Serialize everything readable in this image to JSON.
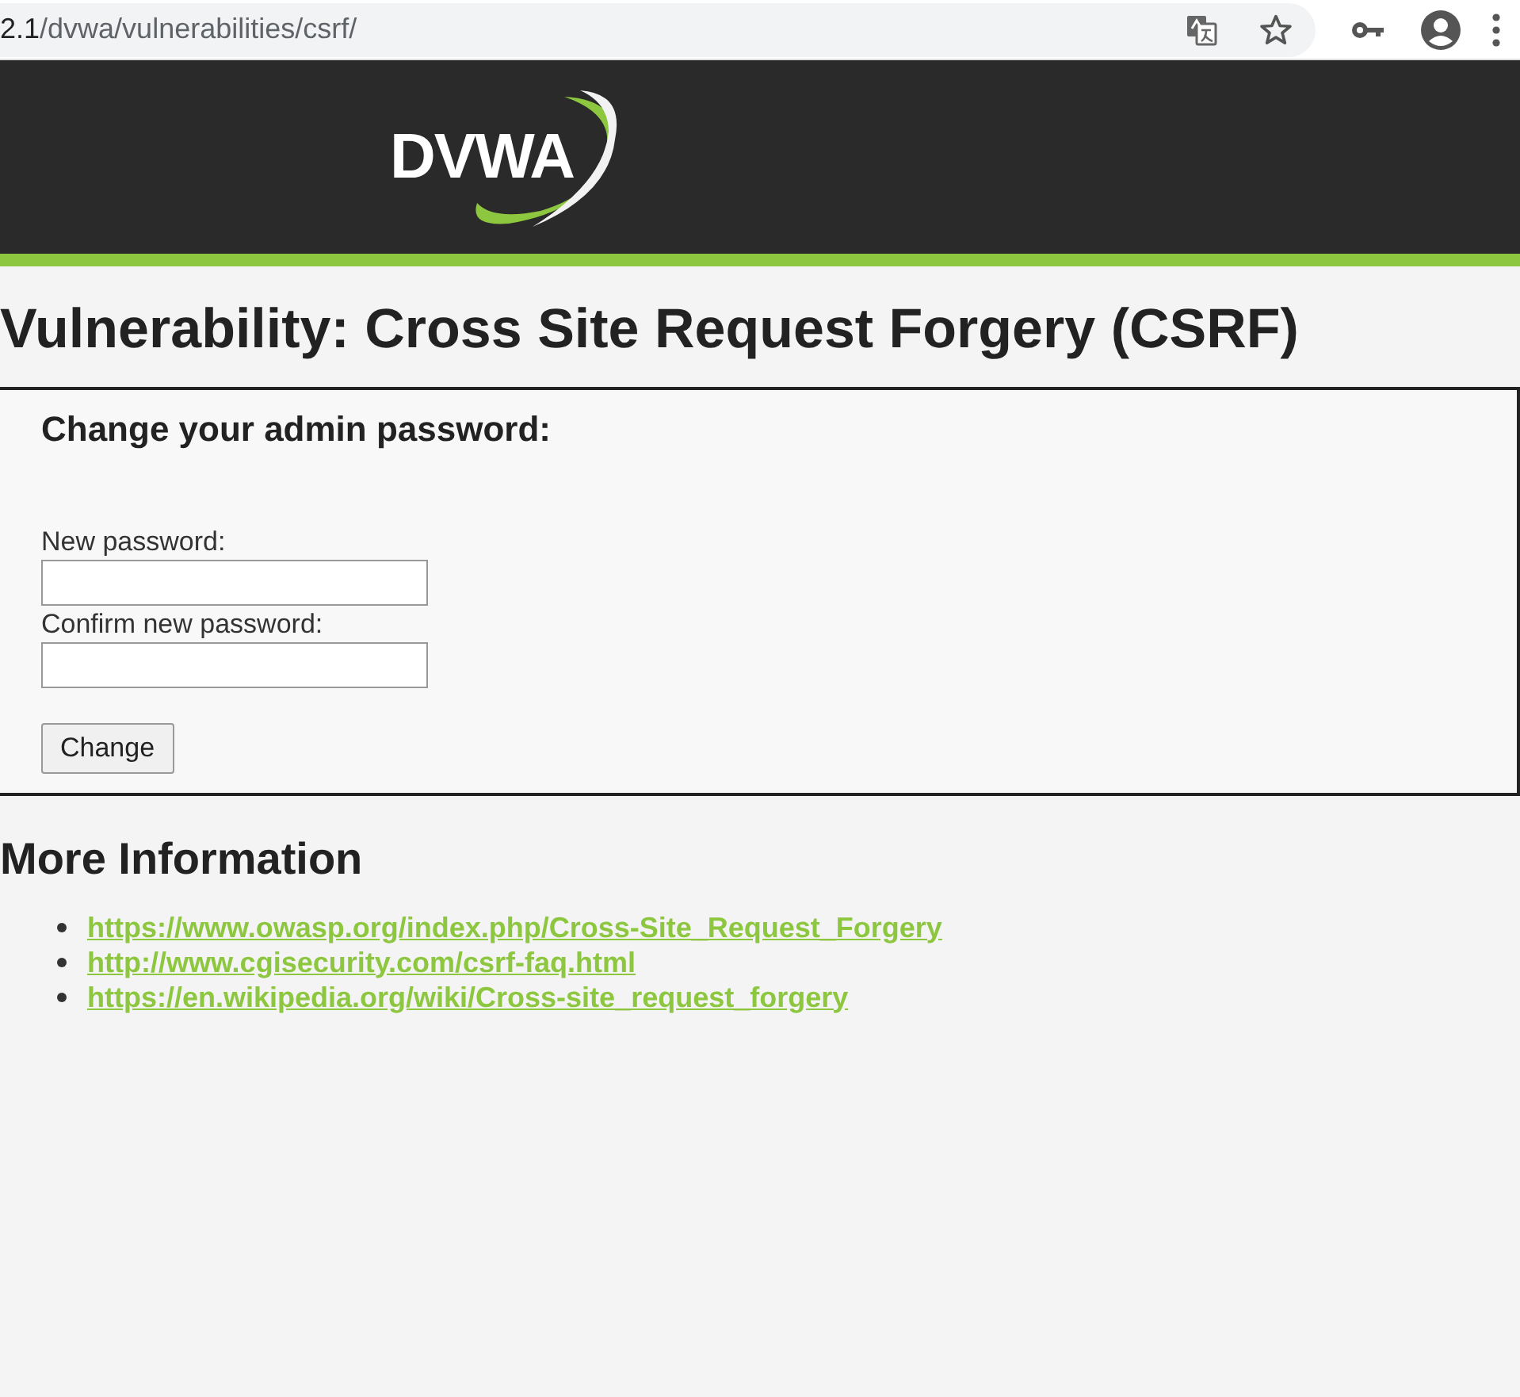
{
  "browser": {
    "address_host": "2.1",
    "address_path": "/dvwa/vulnerabilities/csrf/"
  },
  "header": {
    "logo": "DVWA"
  },
  "title": "Vulnerability: Cross Site Request Forgery (CSRF)",
  "form": {
    "heading": "Change your admin password:",
    "fields": [
      {
        "label": "New password:"
      },
      {
        "label": "Confirm new password:"
      }
    ],
    "button": "Change"
  },
  "more_info": {
    "heading": "More Information",
    "links": [
      "https://www.owasp.org/index.php/Cross-Site_Request_Forgery",
      "http://www.cgisecurity.com/csrf-faq.html",
      "https://en.wikipedia.org/wiki/Cross-site_request_forgery"
    ]
  }
}
